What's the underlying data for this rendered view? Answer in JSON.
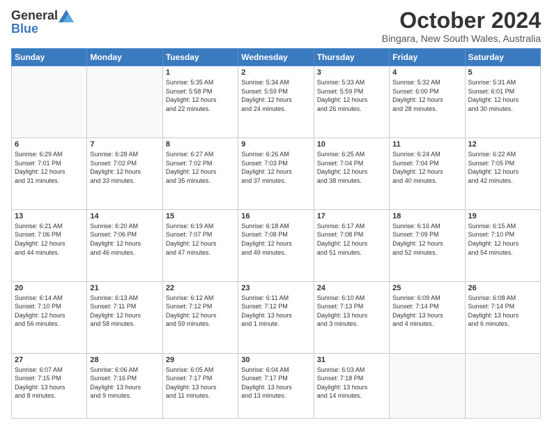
{
  "header": {
    "logo_general": "General",
    "logo_blue": "Blue",
    "month": "October 2024",
    "location": "Bingara, New South Wales, Australia"
  },
  "days_of_week": [
    "Sunday",
    "Monday",
    "Tuesday",
    "Wednesday",
    "Thursday",
    "Friday",
    "Saturday"
  ],
  "weeks": [
    [
      {
        "num": "",
        "info": ""
      },
      {
        "num": "",
        "info": ""
      },
      {
        "num": "1",
        "info": "Sunrise: 5:35 AM\nSunset: 5:58 PM\nDaylight: 12 hours\nand 22 minutes."
      },
      {
        "num": "2",
        "info": "Sunrise: 5:34 AM\nSunset: 5:59 PM\nDaylight: 12 hours\nand 24 minutes."
      },
      {
        "num": "3",
        "info": "Sunrise: 5:33 AM\nSunset: 5:59 PM\nDaylight: 12 hours\nand 26 minutes."
      },
      {
        "num": "4",
        "info": "Sunrise: 5:32 AM\nSunset: 6:00 PM\nDaylight: 12 hours\nand 28 minutes."
      },
      {
        "num": "5",
        "info": "Sunrise: 5:31 AM\nSunset: 6:01 PM\nDaylight: 12 hours\nand 30 minutes."
      }
    ],
    [
      {
        "num": "6",
        "info": "Sunrise: 6:29 AM\nSunset: 7:01 PM\nDaylight: 12 hours\nand 31 minutes."
      },
      {
        "num": "7",
        "info": "Sunrise: 6:28 AM\nSunset: 7:02 PM\nDaylight: 12 hours\nand 33 minutes."
      },
      {
        "num": "8",
        "info": "Sunrise: 6:27 AM\nSunset: 7:02 PM\nDaylight: 12 hours\nand 35 minutes."
      },
      {
        "num": "9",
        "info": "Sunrise: 6:26 AM\nSunset: 7:03 PM\nDaylight: 12 hours\nand 37 minutes."
      },
      {
        "num": "10",
        "info": "Sunrise: 6:25 AM\nSunset: 7:04 PM\nDaylight: 12 hours\nand 38 minutes."
      },
      {
        "num": "11",
        "info": "Sunrise: 6:24 AM\nSunset: 7:04 PM\nDaylight: 12 hours\nand 40 minutes."
      },
      {
        "num": "12",
        "info": "Sunrise: 6:22 AM\nSunset: 7:05 PM\nDaylight: 12 hours\nand 42 minutes."
      }
    ],
    [
      {
        "num": "13",
        "info": "Sunrise: 6:21 AM\nSunset: 7:06 PM\nDaylight: 12 hours\nand 44 minutes."
      },
      {
        "num": "14",
        "info": "Sunrise: 6:20 AM\nSunset: 7:06 PM\nDaylight: 12 hours\nand 46 minutes."
      },
      {
        "num": "15",
        "info": "Sunrise: 6:19 AM\nSunset: 7:07 PM\nDaylight: 12 hours\nand 47 minutes."
      },
      {
        "num": "16",
        "info": "Sunrise: 6:18 AM\nSunset: 7:08 PM\nDaylight: 12 hours\nand 49 minutes."
      },
      {
        "num": "17",
        "info": "Sunrise: 6:17 AM\nSunset: 7:08 PM\nDaylight: 12 hours\nand 51 minutes."
      },
      {
        "num": "18",
        "info": "Sunrise: 6:16 AM\nSunset: 7:09 PM\nDaylight: 12 hours\nand 52 minutes."
      },
      {
        "num": "19",
        "info": "Sunrise: 6:15 AM\nSunset: 7:10 PM\nDaylight: 12 hours\nand 54 minutes."
      }
    ],
    [
      {
        "num": "20",
        "info": "Sunrise: 6:14 AM\nSunset: 7:10 PM\nDaylight: 12 hours\nand 56 minutes."
      },
      {
        "num": "21",
        "info": "Sunrise: 6:13 AM\nSunset: 7:11 PM\nDaylight: 12 hours\nand 58 minutes."
      },
      {
        "num": "22",
        "info": "Sunrise: 6:12 AM\nSunset: 7:12 PM\nDaylight: 12 hours\nand 59 minutes."
      },
      {
        "num": "23",
        "info": "Sunrise: 6:11 AM\nSunset: 7:12 PM\nDaylight: 13 hours\nand 1 minute."
      },
      {
        "num": "24",
        "info": "Sunrise: 6:10 AM\nSunset: 7:13 PM\nDaylight: 13 hours\nand 3 minutes."
      },
      {
        "num": "25",
        "info": "Sunrise: 6:09 AM\nSunset: 7:14 PM\nDaylight: 13 hours\nand 4 minutes."
      },
      {
        "num": "26",
        "info": "Sunrise: 6:08 AM\nSunset: 7:14 PM\nDaylight: 13 hours\nand 6 minutes."
      }
    ],
    [
      {
        "num": "27",
        "info": "Sunrise: 6:07 AM\nSunset: 7:15 PM\nDaylight: 13 hours\nand 8 minutes."
      },
      {
        "num": "28",
        "info": "Sunrise: 6:06 AM\nSunset: 7:16 PM\nDaylight: 13 hours\nand 9 minutes."
      },
      {
        "num": "29",
        "info": "Sunrise: 6:05 AM\nSunset: 7:17 PM\nDaylight: 13 hours\nand 11 minutes."
      },
      {
        "num": "30",
        "info": "Sunrise: 6:04 AM\nSunset: 7:17 PM\nDaylight: 13 hours\nand 13 minutes."
      },
      {
        "num": "31",
        "info": "Sunrise: 6:03 AM\nSunset: 7:18 PM\nDaylight: 13 hours\nand 14 minutes."
      },
      {
        "num": "",
        "info": ""
      },
      {
        "num": "",
        "info": ""
      }
    ]
  ]
}
